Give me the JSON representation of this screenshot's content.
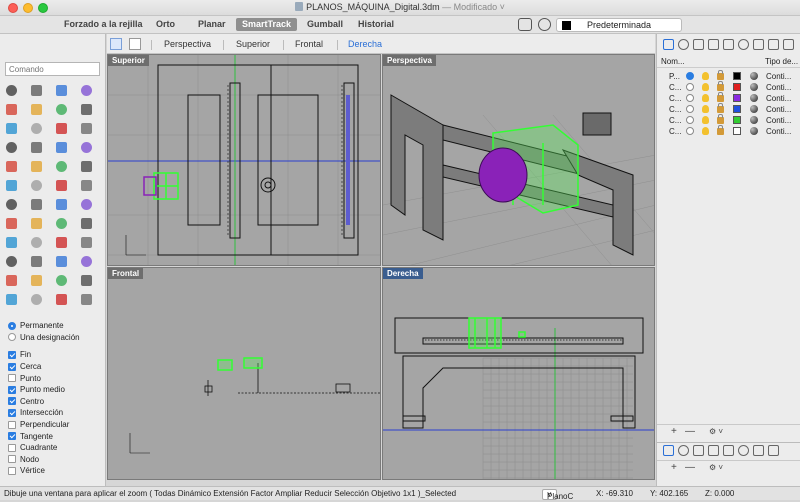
{
  "window": {
    "title": "PLANOS_MÁQUINA_Digital.3dm",
    "modified": "— Modificado ˅"
  },
  "toolbar": {
    "items": [
      "Forzado a la rejilla",
      "Orto",
      "Planar",
      "SmartTrack",
      "Gumball",
      "Historial"
    ],
    "active": "SmartTrack",
    "layer": "Predeterminada"
  },
  "viewtabs": [
    "Perspectiva",
    "Superior",
    "Frontal",
    "Derecha"
  ],
  "viewtabs_active": "Derecha",
  "command": {
    "placeholder": "Comando"
  },
  "viewports": {
    "top": "Superior",
    "perspective": "Perspectiva",
    "front": "Frontal",
    "right": "Derecha"
  },
  "osnap": {
    "permanente": "Permanente",
    "una_designacion": "Una designación",
    "items": [
      {
        "label": "Fin",
        "checked": true
      },
      {
        "label": "Cerca",
        "checked": true
      },
      {
        "label": "Punto",
        "checked": false
      },
      {
        "label": "Punto medio",
        "checked": true
      },
      {
        "label": "Centro",
        "checked": true
      },
      {
        "label": "Intersección",
        "checked": true
      },
      {
        "label": "Perpendicular",
        "checked": false
      },
      {
        "label": "Tangente",
        "checked": true
      },
      {
        "label": "Cuadrante",
        "checked": false
      },
      {
        "label": "Nodo",
        "checked": false
      },
      {
        "label": "Vértice",
        "checked": false
      }
    ]
  },
  "layers": {
    "header_name": "Nom...",
    "header_type": "Tipo de...",
    "rows": [
      {
        "name": "P...",
        "current": true,
        "color": "#000000",
        "linetype": "Conti..."
      },
      {
        "name": "C...",
        "current": false,
        "color": "#e02020",
        "linetype": "Conti..."
      },
      {
        "name": "C...",
        "current": false,
        "color": "#8a2be2",
        "linetype": "Conti..."
      },
      {
        "name": "C...",
        "current": false,
        "color": "#1f4fe0",
        "linetype": "Conti..."
      },
      {
        "name": "C...",
        "current": false,
        "color": "#33cc33",
        "linetype": "Conti..."
      },
      {
        "name": "C...",
        "current": false,
        "color": "#ffffff",
        "linetype": "Conti..."
      }
    ],
    "add": "+",
    "remove": "—",
    "gear": "⚙ ˅"
  },
  "status": {
    "prompt": "Dibuje una ventana para aplicar el zoom ( Todas Dinámico Extensión Factor Ampliar Reducir Selección Objetivo 1x1 )_Selected",
    "plane": "PlanoC",
    "x": "X: -69.310",
    "y": "Y: 402.165",
    "z": "Z: 0.000"
  },
  "colors": {
    "accent": "#2a6fd6",
    "selection": "#33ff33",
    "axis_x": "#2a3fcf",
    "axis_y": "#2fbf3f",
    "purple": "#8a22b8"
  }
}
